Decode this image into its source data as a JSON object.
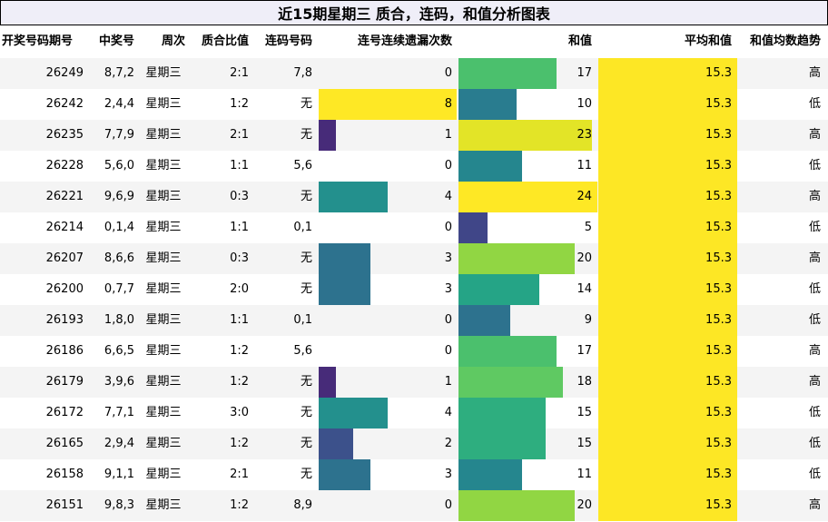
{
  "title": "近15期星期三 质合，连码，和值分析图表",
  "headers": [
    "开奖号码期号",
    "中奖号",
    "周次",
    "质合比值",
    "连码号码",
    "连号连续遗漏次数",
    "和值",
    "平均和值",
    "和值均数趋势"
  ],
  "colors": {
    "header_bg": "#efeef8",
    "row_alt": "#f4f4f4",
    "avg_fill": "#fde725"
  },
  "chart_data": {
    "type": "table",
    "title": "近15期星期三 质合，连码，和值分析图表",
    "columns": [
      "开奖号码期号",
      "中奖号",
      "周次",
      "质合比值",
      "连码号码",
      "连号连续遗漏次数",
      "和值",
      "平均和值",
      "和值均数趋势"
    ],
    "miss_max": 8,
    "sum_max": 24,
    "rows": [
      {
        "issue": "26249",
        "numbers": "8,7,2",
        "weekday": "星期三",
        "ratio": "2:1",
        "consecutive": "7,8",
        "miss": 0,
        "sum": 17,
        "avg": "15.3",
        "trend": "高"
      },
      {
        "issue": "26242",
        "numbers": "2,4,4",
        "weekday": "星期三",
        "ratio": "1:2",
        "consecutive": "无",
        "miss": 8,
        "sum": 10,
        "avg": "15.3",
        "trend": "低"
      },
      {
        "issue": "26235",
        "numbers": "7,7,9",
        "weekday": "星期三",
        "ratio": "2:1",
        "consecutive": "无",
        "miss": 1,
        "sum": 23,
        "avg": "15.3",
        "trend": "高"
      },
      {
        "issue": "26228",
        "numbers": "5,6,0",
        "weekday": "星期三",
        "ratio": "1:1",
        "consecutive": "5,6",
        "miss": 0,
        "sum": 11,
        "avg": "15.3",
        "trend": "低"
      },
      {
        "issue": "26221",
        "numbers": "9,6,9",
        "weekday": "星期三",
        "ratio": "0:3",
        "consecutive": "无",
        "miss": 4,
        "sum": 24,
        "avg": "15.3",
        "trend": "高"
      },
      {
        "issue": "26214",
        "numbers": "0,1,4",
        "weekday": "星期三",
        "ratio": "1:1",
        "consecutive": "0,1",
        "miss": 0,
        "sum": 5,
        "avg": "15.3",
        "trend": "低"
      },
      {
        "issue": "26207",
        "numbers": "8,6,6",
        "weekday": "星期三",
        "ratio": "0:3",
        "consecutive": "无",
        "miss": 3,
        "sum": 20,
        "avg": "15.3",
        "trend": "高"
      },
      {
        "issue": "26200",
        "numbers": "0,7,7",
        "weekday": "星期三",
        "ratio": "2:0",
        "consecutive": "无",
        "miss": 3,
        "sum": 14,
        "avg": "15.3",
        "trend": "低"
      },
      {
        "issue": "26193",
        "numbers": "1,8,0",
        "weekday": "星期三",
        "ratio": "1:1",
        "consecutive": "0,1",
        "miss": 0,
        "sum": 9,
        "avg": "15.3",
        "trend": "低"
      },
      {
        "issue": "26186",
        "numbers": "6,6,5",
        "weekday": "星期三",
        "ratio": "1:2",
        "consecutive": "5,6",
        "miss": 0,
        "sum": 17,
        "avg": "15.3",
        "trend": "高"
      },
      {
        "issue": "26179",
        "numbers": "3,9,6",
        "weekday": "星期三",
        "ratio": "1:2",
        "consecutive": "无",
        "miss": 1,
        "sum": 18,
        "avg": "15.3",
        "trend": "高"
      },
      {
        "issue": "26172",
        "numbers": "7,7,1",
        "weekday": "星期三",
        "ratio": "3:0",
        "consecutive": "无",
        "miss": 4,
        "sum": 15,
        "avg": "15.3",
        "trend": "低"
      },
      {
        "issue": "26165",
        "numbers": "2,9,4",
        "weekday": "星期三",
        "ratio": "1:2",
        "consecutive": "无",
        "miss": 2,
        "sum": 15,
        "avg": "15.3",
        "trend": "低"
      },
      {
        "issue": "26158",
        "numbers": "9,1,1",
        "weekday": "星期三",
        "ratio": "2:1",
        "consecutive": "无",
        "miss": 3,
        "sum": 11,
        "avg": "15.3",
        "trend": "低"
      },
      {
        "issue": "26151",
        "numbers": "9,8,3",
        "weekday": "星期三",
        "ratio": "1:2",
        "consecutive": "8,9",
        "miss": 0,
        "sum": 20,
        "avg": "15.3",
        "trend": "高"
      }
    ]
  }
}
